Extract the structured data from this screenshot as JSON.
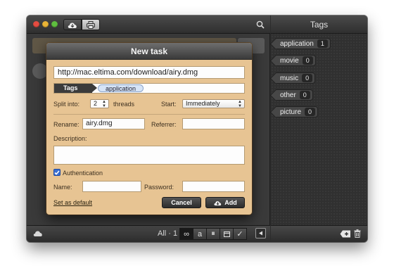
{
  "main": {
    "toolbar": {
      "filter_label": "All · 1",
      "filter_buttons": [
        "∞",
        "a",
        "⏸",
        "",
        "✓"
      ]
    }
  },
  "tags_panel": {
    "title": "Tags",
    "items": [
      {
        "name": "application",
        "count": "1"
      },
      {
        "name": "movie",
        "count": "0"
      },
      {
        "name": "music",
        "count": "0"
      },
      {
        "name": "other",
        "count": "0"
      },
      {
        "name": "picture",
        "count": "0"
      }
    ]
  },
  "dialog": {
    "title": "New task",
    "url": "http://mac.eltima.com/download/airy.dmg",
    "tags_label": "Tags",
    "selected_tag": "application",
    "split_label": "Split into:",
    "split_value": "2",
    "threads_label": "threads",
    "start_label": "Start:",
    "start_value": "Immediately",
    "rename_label": "Rename:",
    "rename_value": "airy.dmg",
    "referrer_label": "Referrer:",
    "referrer_value": "",
    "description_label": "Description:",
    "description_value": "",
    "auth_label": "Authentication",
    "auth_checked": true,
    "name_label": "Name:",
    "name_value": "",
    "password_label": "Password:",
    "password_value": "",
    "default_link": "Set as default",
    "cancel_label": "Cancel",
    "add_label": "Add"
  },
  "colors": {
    "dialog_bg": "#e7c493",
    "checkbox_accent": "#3a6fd2",
    "traffic_close": "#e44c41",
    "traffic_min": "#e9b436",
    "traffic_max": "#5fbf3f"
  }
}
